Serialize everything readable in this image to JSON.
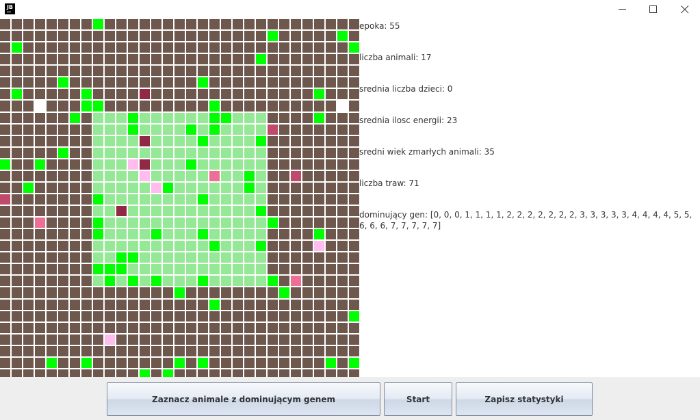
{
  "window": {
    "logo_text": "JB"
  },
  "stats": [
    {
      "label": "epoka: 55"
    },
    {
      "label": "liczba animali: 17"
    },
    {
      "label": "srednia liczba dzieci: 0"
    },
    {
      "label": "srednia ilosc energii: 23"
    },
    {
      "label": "sredni wiek zmarłych animali: 35"
    },
    {
      "label": "liczba traw: 71"
    },
    {
      "label": "dominujący gen: [0, 0, 0, 1, 1, 1, 1, 2, 2, 2, 2, 2, 2, 2, 3, 3, 3, 3, 3, 4, 4, 4, 4, 5, 5, 6, 6, 6, 7, 7, 7, 7, 7]"
    }
  ],
  "buttons": {
    "mark_dominant": "Zaznacz animale z dominującym genem",
    "start": "Start",
    "save_stats": "Zapisz statystyki"
  },
  "map": {
    "size": 31,
    "jungle": {
      "rows": [
        8,
        22
      ],
      "cols": [
        8,
        22
      ]
    },
    "colors": {
      "steppe": "#6e584e",
      "jungle": "#95e895",
      "grass": "#00ff00",
      "empty_marked": "#ffffff",
      "animal_low": "#ffbcee",
      "animal_mid": "#ee6f96",
      "animal_high": "#c04a6c",
      "animal_top": "#902846"
    },
    "grass": [
      [
        0,
        8
      ],
      [
        1,
        23
      ],
      [
        1,
        29
      ],
      [
        2,
        1
      ],
      [
        2,
        30
      ],
      [
        3,
        22
      ],
      [
        5,
        5
      ],
      [
        5,
        17
      ],
      [
        6,
        1
      ],
      [
        6,
        7
      ],
      [
        6,
        27
      ],
      [
        7,
        7
      ],
      [
        7,
        8
      ],
      [
        7,
        18
      ],
      [
        8,
        6
      ],
      [
        8,
        11
      ],
      [
        8,
        18
      ],
      [
        8,
        19
      ],
      [
        8,
        27
      ],
      [
        9,
        11
      ],
      [
        9,
        16
      ],
      [
        9,
        18
      ],
      [
        10,
        17
      ],
      [
        10,
        22
      ],
      [
        11,
        5
      ],
      [
        12,
        0
      ],
      [
        12,
        3
      ],
      [
        12,
        16
      ],
      [
        13,
        21
      ],
      [
        14,
        2
      ],
      [
        14,
        14
      ],
      [
        14,
        21
      ],
      [
        15,
        8
      ],
      [
        15,
        17
      ],
      [
        16,
        22
      ],
      [
        17,
        8
      ],
      [
        17,
        23
      ],
      [
        18,
        8
      ],
      [
        18,
        13
      ],
      [
        18,
        17
      ],
      [
        18,
        27
      ],
      [
        19,
        18
      ],
      [
        19,
        22
      ],
      [
        20,
        10
      ],
      [
        20,
        11
      ],
      [
        21,
        8
      ],
      [
        21,
        9
      ],
      [
        21,
        10
      ],
      [
        22,
        9
      ],
      [
        22,
        11
      ],
      [
        22,
        13
      ],
      [
        22,
        17
      ],
      [
        22,
        23
      ],
      [
        23,
        15
      ],
      [
        23,
        24
      ],
      [
        24,
        18
      ],
      [
        25,
        30
      ],
      [
        29,
        4
      ],
      [
        29,
        7
      ],
      [
        29,
        15
      ],
      [
        29,
        17
      ],
      [
        29,
        28
      ],
      [
        29,
        30
      ],
      [
        30,
        12
      ],
      [
        30,
        14
      ]
    ],
    "empty_marked": [
      [
        7,
        3
      ],
      [
        7,
        29
      ]
    ],
    "animals": [
      {
        "r": 6,
        "c": 12,
        "energy": "top"
      },
      {
        "r": 9,
        "c": 23,
        "energy": "high"
      },
      {
        "r": 10,
        "c": 12,
        "energy": "top"
      },
      {
        "r": 12,
        "c": 11,
        "energy": "low"
      },
      {
        "r": 12,
        "c": 12,
        "energy": "top"
      },
      {
        "r": 13,
        "c": 12,
        "energy": "low"
      },
      {
        "r": 13,
        "c": 18,
        "energy": "mid"
      },
      {
        "r": 13,
        "c": 25,
        "energy": "high"
      },
      {
        "r": 14,
        "c": 13,
        "energy": "low"
      },
      {
        "r": 15,
        "c": 0,
        "energy": "high"
      },
      {
        "r": 16,
        "c": 10,
        "energy": "top"
      },
      {
        "r": 17,
        "c": 3,
        "energy": "mid"
      },
      {
        "r": 19,
        "c": 27,
        "energy": "low"
      },
      {
        "r": 22,
        "c": 25,
        "energy": "mid"
      },
      {
        "r": 27,
        "c": 9,
        "energy": "low"
      }
    ]
  }
}
